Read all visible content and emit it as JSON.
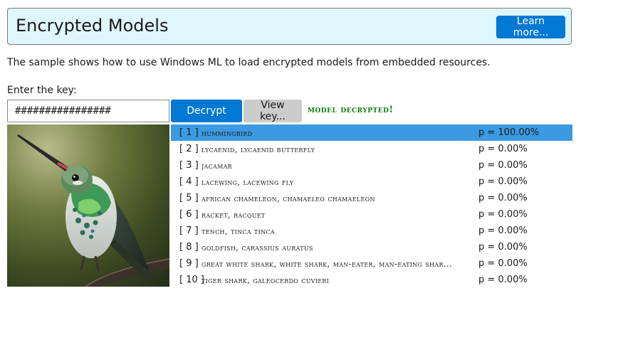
{
  "header": {
    "title": "Encrypted Models",
    "learn_more_label": "Learn more..."
  },
  "description": "The sample shows how to use Windows ML to load encrypted models from embedded resources.",
  "key": {
    "label": "Enter the key:",
    "value": "################"
  },
  "buttons": {
    "decrypt_label": "Decrypt",
    "view_key_label": "View key..."
  },
  "status": "model decrypted!",
  "results": [
    {
      "rank": "[ 1 ]",
      "label": "hummingbird",
      "prob": "p = 100.00%",
      "selected": true
    },
    {
      "rank": "[ 2 ]",
      "label": "lycaenid, lycaenid butterfly",
      "prob": "p = 0.00%"
    },
    {
      "rank": "[ 3 ]",
      "label": "jacamar",
      "prob": "p = 0.00%"
    },
    {
      "rank": "[ 4 ]",
      "label": "lacewing, lacewing fly",
      "prob": "p = 0.00%"
    },
    {
      "rank": "[ 5 ]",
      "label": "african chameleon, chamaeleo chamaeleon",
      "prob": "p = 0.00%"
    },
    {
      "rank": "[ 6 ]",
      "label": "racket, racquet",
      "prob": "p = 0.00%"
    },
    {
      "rank": "[ 7 ]",
      "label": "tench, tinca tinca",
      "prob": "p = 0.00%"
    },
    {
      "rank": "[ 8 ]",
      "label": "goldfish, carassius auratus",
      "prob": "p = 0.00%"
    },
    {
      "rank": "[ 9 ]",
      "label": "great white shark, white shark, man-eater, man-eating shar...",
      "prob": "p = 0.00%"
    },
    {
      "rank": "[ 10 ]",
      "label": "tiger shark, galeocerdo cuvieri",
      "prob": "p = 0.00%"
    }
  ],
  "colors": {
    "header_bg": "#dff6fd",
    "accent": "#0078d4",
    "selected_row": "#3b9ae1",
    "status_green": "#0a7d0a"
  }
}
